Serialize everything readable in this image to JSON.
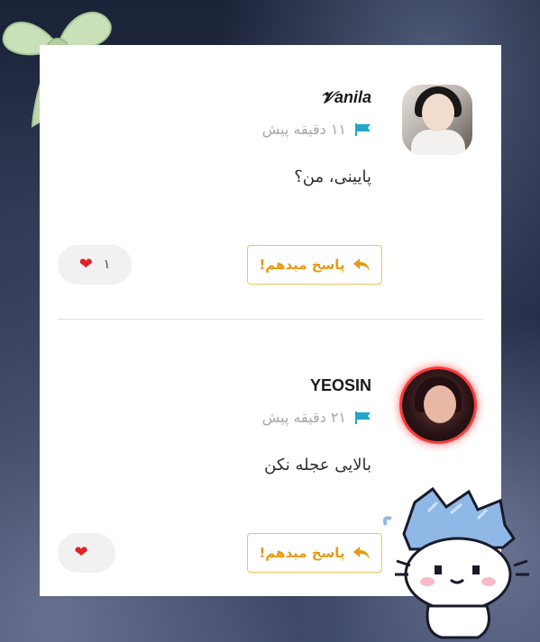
{
  "comments": [
    {
      "username": "𝓥anila",
      "time": "۱۱ دقیقه پیش",
      "text": "پایینی، من؟",
      "reply_label": "پاسخ میدهم!",
      "likes": "۱"
    },
    {
      "username": "YEOSIN",
      "time": "۲۱ دقیقه پیش",
      "text": "بالایی عجله نکن",
      "reply_label": "پاسخ میدهم!",
      "likes": ""
    }
  ],
  "colors": {
    "accent": "#e59a13",
    "flag": "#23a6c9",
    "heart": "#e0202a",
    "avatar_ring": "#ff3b3b"
  },
  "icons": [
    "flag-icon",
    "reply-arrow-icon",
    "heart-icon",
    "ribbon-bow-sticker",
    "cat-sticker"
  ]
}
